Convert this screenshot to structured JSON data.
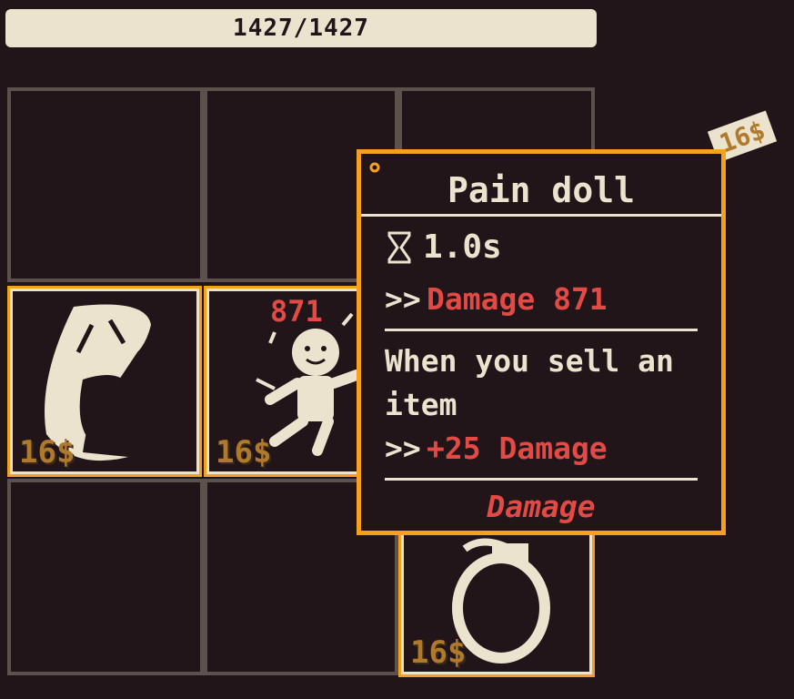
{
  "hp": {
    "value": "1427/1427"
  },
  "items": [
    {
      "price": "16$"
    },
    {
      "price": "16$",
      "damage": "871"
    },
    {
      "price": "16$"
    }
  ],
  "tag": {
    "price": "16$"
  },
  "tooltip": {
    "title": "Pain doll",
    "cooldown": "1.0s",
    "damage_arrow": ">>",
    "damage_text": "Damage 871",
    "desc_line1": "When you sell an",
    "desc_line2": "item",
    "bonus_arrow": ">>",
    "bonus_text": "+25 Damage",
    "tag": "Damage"
  },
  "colors": {
    "accent": "#f5a11d",
    "damage": "#e24a45",
    "price": "#b07a2c",
    "bg": "#211519",
    "cream": "#ece3cf"
  }
}
